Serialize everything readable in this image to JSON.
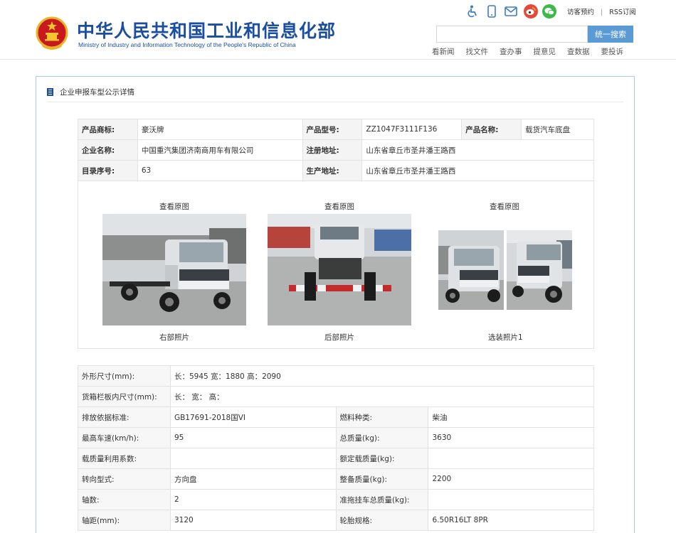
{
  "header": {
    "title_cn": "中华人民共和国工业和信息化部",
    "title_en": "Ministry of Industry and Information Technology of the People's Republic of China",
    "icons": [
      "accessibility-icon",
      "mobile-icon",
      "mail-icon",
      "weibo-icon",
      "wechat-icon"
    ],
    "links": {
      "visitor": "访客预约",
      "rss": "RSS订阅"
    },
    "search": {
      "value": "",
      "button": "统一搜索"
    },
    "nav": [
      "看新闻",
      "找文件",
      "查办事",
      "提意见",
      "查数据",
      "要投诉"
    ],
    "colors": {
      "brand": "#1a4ea1",
      "accent": "#5b9bd5",
      "weibo": "#e6493a",
      "wechat": "#3db94a"
    }
  },
  "panel": {
    "heading": "企业申报车型公示详情"
  },
  "info": {
    "row1": {
      "k1": "产品商标:",
      "v1": "豪沃牌",
      "k2": "产品型号:",
      "v2": "ZZ1047F3111F136",
      "k3": "产品名称:",
      "v3": "载货汽车底盘"
    },
    "row2": {
      "k1": "企业名称:",
      "v1": "中国重汽集团济南商用车有限公司",
      "k2": "注册地址:",
      "v2": "山东省章丘市圣井潘王路西"
    },
    "row3": {
      "k1": "目录序号:",
      "v1": "63",
      "k2": "生产地址:",
      "v2": "山东省章丘市圣井潘王路西"
    }
  },
  "photos": [
    {
      "link": "查看原图",
      "caption": "右部照片"
    },
    {
      "link": "查看原图",
      "caption": "后部照片"
    },
    {
      "link": "查看原图",
      "caption": "选装照片1"
    }
  ],
  "params": {
    "r1": {
      "k1": "外形尺寸(mm):",
      "v1": "长：5945 宽：1880 高：2090"
    },
    "r2": {
      "k1": "货箱栏板内尺寸(mm):",
      "v1": "长：  宽：  高："
    },
    "r3": {
      "k1": "排放依据标准:",
      "v1": "GB17691-2018国VI",
      "k2": "燃料种类:",
      "v2": "柴油"
    },
    "r4": {
      "k1": "最高车速(km/h):",
      "v1": "95",
      "k2": "总质量(kg):",
      "v2": "3630"
    },
    "r5": {
      "k1": "载质量利用系数:",
      "v1": "",
      "k2": "额定载质量(kg):",
      "v2": ""
    },
    "r6": {
      "k1": "转向型式:",
      "v1": "方向盘",
      "k2": "整备质量(kg):",
      "v2": "2200"
    },
    "r7": {
      "k1": "轴数:",
      "v1": "2",
      "k2": "准拖挂车总质量(kg):",
      "v2": ""
    },
    "r8": {
      "k1": "轴距(mm):",
      "v1": "3120",
      "k2": "轮胎规格:",
      "v2": "6.50R16LT 8PR"
    }
  }
}
